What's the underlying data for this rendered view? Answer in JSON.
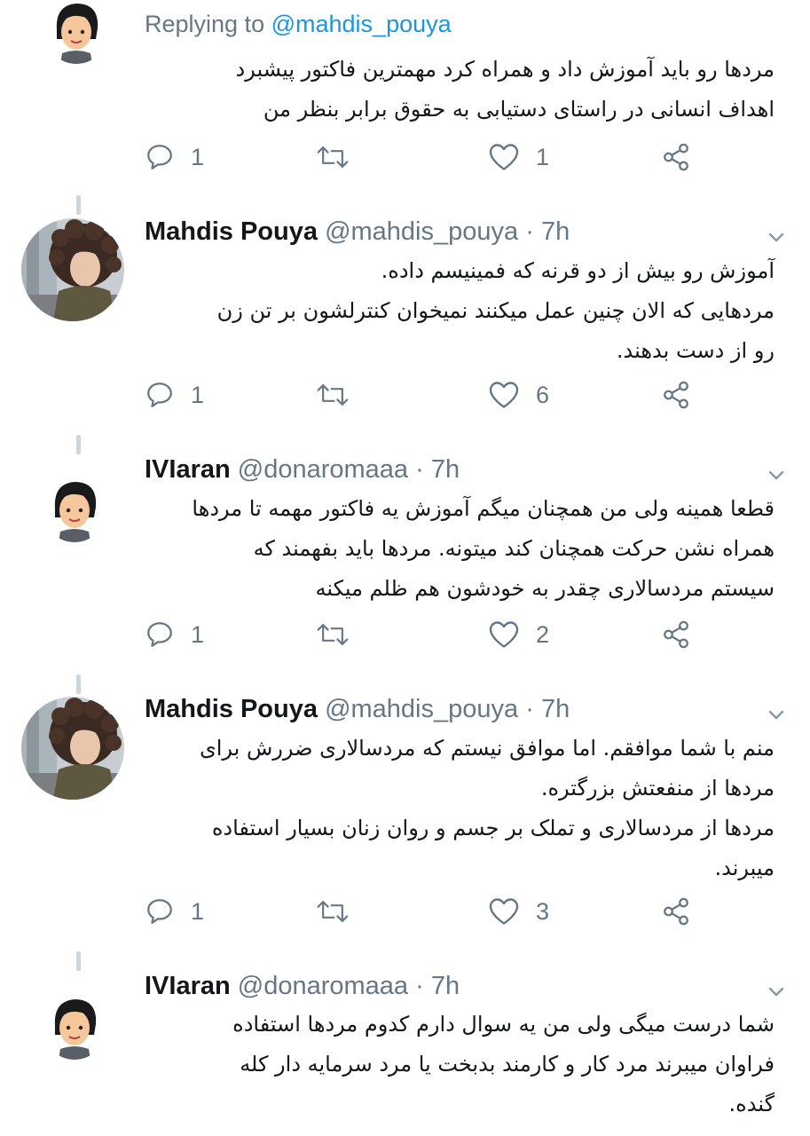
{
  "replying": {
    "prefix": "Replying to",
    "handle": "@mahdis_pouya"
  },
  "tweets": [
    {
      "name": "",
      "handle": "",
      "time": "",
      "lines": [
        "مردها رو باید آموزش داد و همراه کرد مهمترین فاکتور پیشبرد",
        "اهداف انسانی در راستای دستیابی به حقوق برابر بنظر من"
      ],
      "replies": "1",
      "retweets": "",
      "likes": "1"
    },
    {
      "name": "Mahdis Pouya",
      "handle": "@mahdis_pouya",
      "dot": "·",
      "time": "7h",
      "lines": [
        "آموزش رو بیش از دو قرنه که فمینیسم داده.",
        "مردهایی که الان چنین عمل میکنند نمیخوان کنترلشون بر تن زن",
        "رو از دست بدهند."
      ],
      "replies": "1",
      "retweets": "",
      "likes": "6"
    },
    {
      "name": "IVIaran",
      "handle": "@donaromaaa",
      "dot": "·",
      "time": "7h",
      "lines": [
        "قطعا همینه ولی من همچنان میگم آموزش یه فاکتور مهمه تا مردها",
        "همراه نشن حرکت همچنان کند میتونه. مردها باید بفهمند که",
        "سیستم مردسالاری چقدر به خودشون هم ظلم میکنه"
      ],
      "replies": "1",
      "retweets": "",
      "likes": "2"
    },
    {
      "name": "Mahdis Pouya",
      "handle": "@mahdis_pouya",
      "dot": "·",
      "time": "7h",
      "lines": [
        "منم با شما موافقم. اما موافق نیستم که مردسالاری ضررش برای",
        "مردها از منفعتش بزرگتره.",
        "مردها از مردسالاری و تملک بر جسم و روان زنان بسیار استفاده",
        "میبرند."
      ],
      "replies": "1",
      "retweets": "",
      "likes": "3"
    },
    {
      "name": "IVIaran",
      "handle": "@donaromaaa",
      "dot": "·",
      "time": "7h",
      "lines": [
        "شما درست میگی ولی من یه سوال دارم کدوم مردها استفاده",
        "فراوان میبرند مرد کار و کارمند بدبخت یا مرد سرمایه دار کله",
        "گنده."
      ]
    }
  ],
  "icons": {
    "reply": "reply-icon",
    "retweet": "retweet-icon",
    "like": "heart-icon",
    "share": "share-icon",
    "caret": "chevron-down-icon"
  },
  "colors": {
    "link": "#1b95e0",
    "muted": "#657786",
    "text": "#14171a",
    "thread_line": "#ccd6dd"
  }
}
